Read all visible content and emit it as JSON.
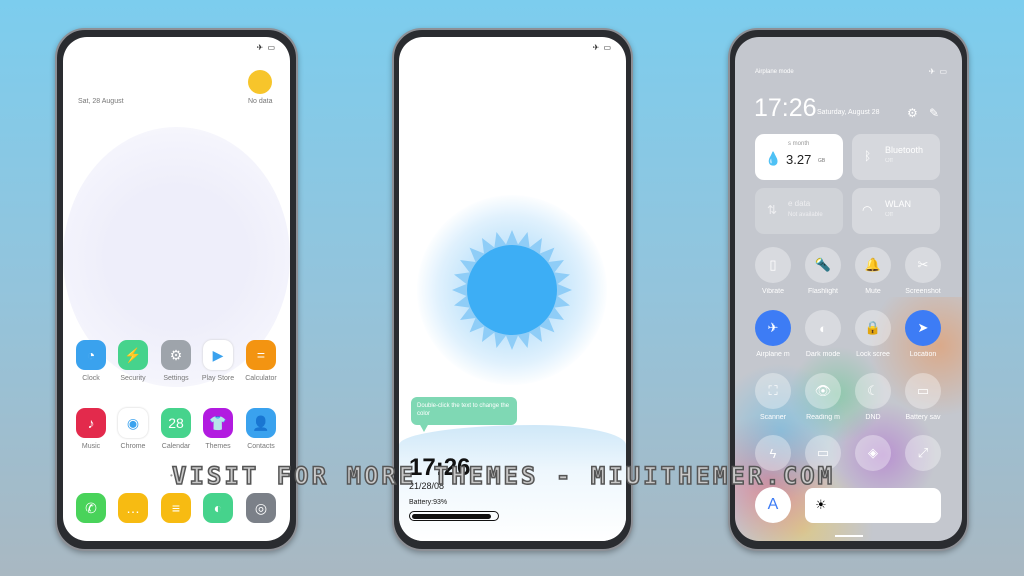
{
  "home": {
    "date": "Sat, 28 August",
    "weather": "No data",
    "status_icons": "✈ ▭",
    "apps": [
      {
        "label": "Clock",
        "color": "#3aa2ee",
        "glyph": "◔"
      },
      {
        "label": "Security",
        "color": "#46d38c",
        "glyph": "⚡"
      },
      {
        "label": "Settings",
        "color": "#9ea4ab",
        "glyph": "⚙"
      },
      {
        "label": "Play Store",
        "color": "#ffffff",
        "glyph": "▶"
      },
      {
        "label": "Calculator",
        "color": "#f39411",
        "glyph": "="
      },
      {
        "label": "Music",
        "color": "#e32a4c",
        "glyph": "♪"
      },
      {
        "label": "Chrome",
        "color": "#ffffff",
        "glyph": "◉"
      },
      {
        "label": "Calendar",
        "color": "#46d38c",
        "glyph": "28"
      },
      {
        "label": "Themes",
        "color": "#b21be0",
        "glyph": "👕"
      },
      {
        "label": "Contacts",
        "color": "#3aa2ee",
        "glyph": "👤"
      }
    ],
    "dock": [
      {
        "name": "phone",
        "color": "#49d35a",
        "glyph": "✆"
      },
      {
        "name": "messages",
        "color": "#f7bb12",
        "glyph": "…"
      },
      {
        "name": "notes",
        "color": "#f7bb12",
        "glyph": "≡"
      },
      {
        "name": "browser",
        "color": "#46d38c",
        "glyph": "◐"
      },
      {
        "name": "camera",
        "color": "#7b8088",
        "glyph": "◎"
      }
    ]
  },
  "lock": {
    "tooltip": "Double-click the text to change the color",
    "time": "17:26",
    "date": "21/28/08",
    "battery": "Battery:93%",
    "battery_level": 0.93,
    "status_icons": "✈ ▭"
  },
  "control": {
    "mode": "Airplane mode",
    "status_icons": "✈ ▭",
    "time": "17:26",
    "date": "Saturday, August 28",
    "data_tile": {
      "label": "s month",
      "value": "3.27",
      "unit": "GB"
    },
    "bluetooth": {
      "label": "Bluetooth",
      "state": "Off"
    },
    "mobile": {
      "label": "e data",
      "state": "Not available"
    },
    "wlan": {
      "label": "WLAN",
      "state": "Off"
    },
    "toggles": [
      {
        "label": "Vibrate",
        "glyph": "▯",
        "on": false
      },
      {
        "label": "Flashlight",
        "glyph": "🔦",
        "on": false
      },
      {
        "label": "Mute",
        "glyph": "🔔",
        "on": false
      },
      {
        "label": "Screenshot",
        "glyph": "✂",
        "on": false
      },
      {
        "label": "Airplane m",
        "glyph": "✈",
        "on": true
      },
      {
        "label": "Dark mode",
        "glyph": "◐",
        "on": false
      },
      {
        "label": "Lock scree",
        "glyph": "🔒",
        "on": false
      },
      {
        "label": "Location",
        "glyph": "➤",
        "on": true
      },
      {
        "label": "Scanner",
        "glyph": "⛶",
        "on": false
      },
      {
        "label": "Reading m",
        "glyph": "👁",
        "on": false
      },
      {
        "label": "DND",
        "glyph": "☾",
        "on": false
      },
      {
        "label": "Battery sav",
        "glyph": "▭",
        "on": false
      },
      {
        "label": "",
        "glyph": "ϟ",
        "on": false
      },
      {
        "label": "",
        "glyph": "▭",
        "on": false
      },
      {
        "label": "",
        "glyph": "◈",
        "on": false
      },
      {
        "label": "",
        "glyph": "⤢",
        "on": false
      }
    ],
    "auto_brightness": "A",
    "accent": "#3d7cf5"
  },
  "watermark": "VISIT FOR MORE THEMES - MIUITHEMER.COM"
}
